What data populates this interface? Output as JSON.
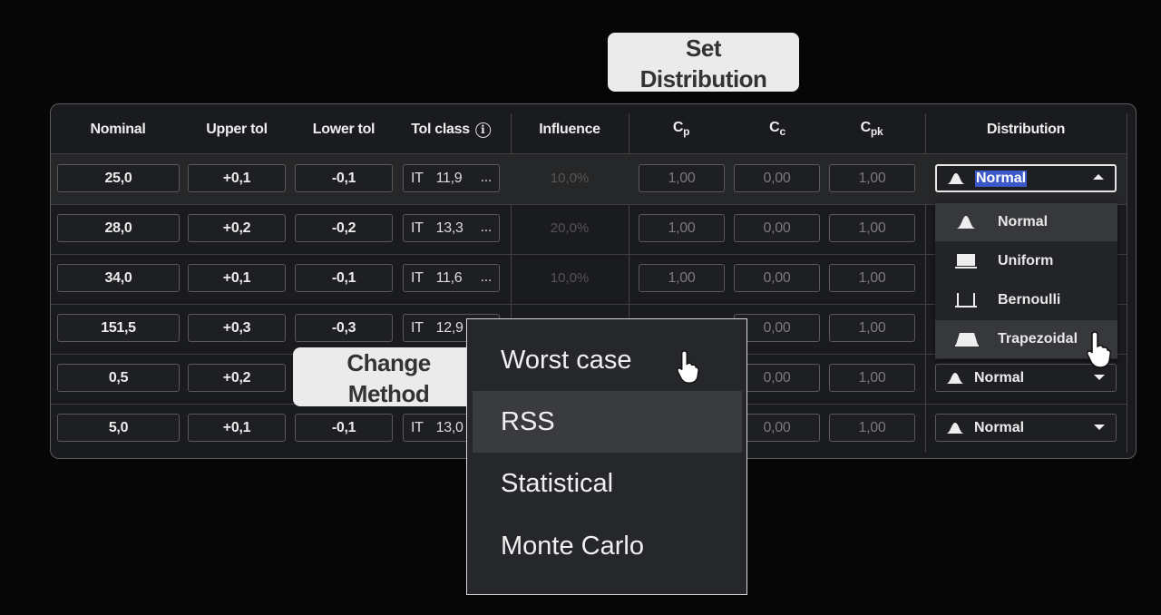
{
  "callouts": {
    "set_distribution": [
      "Set",
      "Distribution"
    ],
    "change_method": [
      "Change",
      "Method"
    ]
  },
  "headers": {
    "nominal": "Nominal",
    "upper_tol": "Upper tol",
    "lower_tol": "Lower tol",
    "tol_class": "Tol class",
    "info_glyph": "i",
    "influence": "Influence",
    "cp_main": "C",
    "cp_sub": "p",
    "cc_main": "C",
    "cc_sub": "c",
    "cpk_main": "C",
    "cpk_sub": "pk",
    "distribution": "Distribution"
  },
  "rows": [
    {
      "nominal": "25,0",
      "upper": "+0,1",
      "lower": "-0,1",
      "it_prefix": "IT",
      "it_value": "11,9",
      "it_more": "...",
      "influence": "10,0%",
      "cp": "1,00",
      "cc": "0,00",
      "cpk": "1,00",
      "distribution": "Normal"
    },
    {
      "nominal": "28,0",
      "upper": "+0,2",
      "lower": "-0,2",
      "it_prefix": "IT",
      "it_value": "13,3",
      "it_more": "...",
      "influence": "20,0%",
      "cp": "1,00",
      "cc": "0,00",
      "cpk": "1,00",
      "distribution": ""
    },
    {
      "nominal": "34,0",
      "upper": "+0,1",
      "lower": "-0,1",
      "it_prefix": "IT",
      "it_value": "11,6",
      "it_more": "...",
      "influence": "10,0%",
      "cp": "1,00",
      "cc": "0,00",
      "cpk": "1,00",
      "distribution": ""
    },
    {
      "nominal": "151,5",
      "upper": "+0,3",
      "lower": "-0,3",
      "it_prefix": "IT",
      "it_value": "12,9",
      "it_more": "",
      "influence": "",
      "cp": "",
      "cc": "0,00",
      "cpk": "1,00",
      "distribution": ""
    },
    {
      "nominal": "0,5",
      "upper": "+0,2",
      "lower": "",
      "it_prefix": "",
      "it_value": "",
      "it_more": "",
      "influence": "",
      "cp": "",
      "cc": "0,00",
      "cpk": "1,00",
      "distribution": "Normal"
    },
    {
      "nominal": "5,0",
      "upper": "+0,1",
      "lower": "-0,1",
      "it_prefix": "IT",
      "it_value": "13,0",
      "it_more": "",
      "influence": "",
      "cp": "",
      "cc": "0,00",
      "cpk": "1,00",
      "distribution": "Normal"
    }
  ],
  "distribution_menu": {
    "options": [
      "Normal",
      "Uniform",
      "Bernoulli",
      "Trapezoidal"
    ],
    "icons": [
      "normal-curve-icon",
      "uniform-block-icon",
      "bernoulli-bracket-icon",
      "trapezoid-icon"
    ],
    "highlighted": [
      "Normal",
      "Trapezoidal"
    ]
  },
  "method_menu": {
    "options": [
      "Worst case",
      "RSS",
      "Statistical",
      "Monte Carlo"
    ],
    "highlighted": "RSS"
  },
  "colors": {
    "background": "#060606",
    "panel": "#1a1b1e",
    "selection": "#3a58c8",
    "callout": "#ebebeb"
  }
}
